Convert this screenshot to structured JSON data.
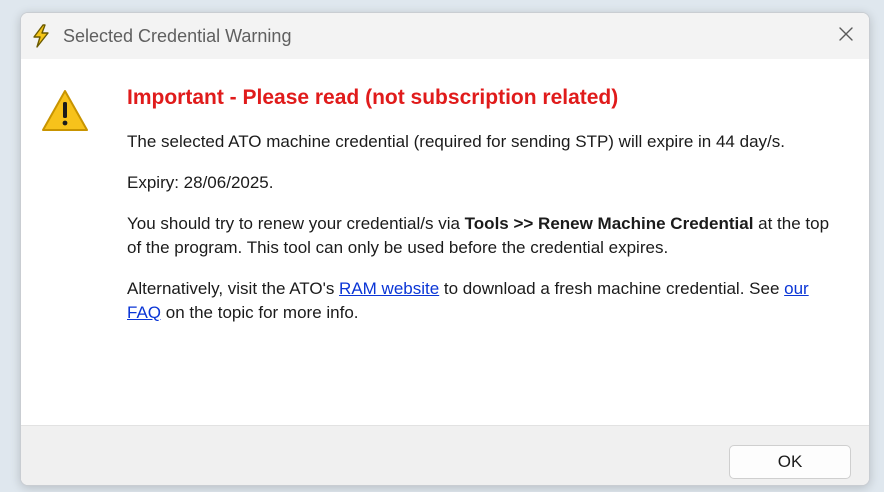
{
  "window": {
    "title": "Selected Credential Warning",
    "icon": "lightning-bolt-icon",
    "close_icon": "close-icon"
  },
  "message": {
    "icon": "warning-triangle-icon",
    "heading": "Important - Please read (not subscription related)",
    "heading_color": "#e01b1b",
    "paragraph1": "The selected ATO machine credential (required for sending STP) will expire in 44 day/s.",
    "paragraph2": "Expiry: 28/06/2025.",
    "paragraph3": {
      "text_before": "You should try to renew your credential/s via ",
      "bold": "Tools >> Renew Machine Credential",
      "text_after": " at the top of the program. This tool can only be used before the credential expires."
    },
    "paragraph4": {
      "text_before": "Alternatively, visit the ATO's ",
      "link1": "RAM website",
      "text_middle": " to download a fresh machine credential. See ",
      "link2": "our FAQ",
      "text_after": " on the topic for more info."
    },
    "link_color": "#0a35d6"
  },
  "footer": {
    "ok_label": "OK"
  }
}
